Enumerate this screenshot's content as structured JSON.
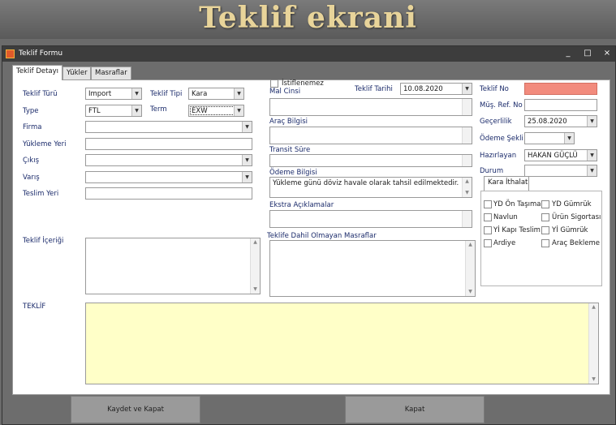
{
  "banner": {
    "title": "Teklif ekrani"
  },
  "window": {
    "title": "Teklif Formu",
    "minimize": "_",
    "maximize": "□",
    "close": "×"
  },
  "tabs": [
    {
      "label": "Teklif Detayı"
    },
    {
      "label": "Yükler"
    },
    {
      "label": "Masraflar"
    }
  ],
  "left": {
    "teklif_turu": {
      "label": "Teklif Türü",
      "value": "Import"
    },
    "teklif_tipi": {
      "label": "Teklif Tipi",
      "value": "Kara"
    },
    "type": {
      "label": "Type",
      "value": "FTL"
    },
    "term": {
      "label": "Term",
      "value": "EXW"
    },
    "firma": {
      "label": "Firma",
      "value": ""
    },
    "yukleme_yeri": {
      "label": "Yükleme Yeri",
      "value": ""
    },
    "cikis": {
      "label": "Çıkış",
      "value": ""
    },
    "varis": {
      "label": "Varış",
      "value": ""
    },
    "teslim_yeri": {
      "label": "Teslim Yeri",
      "value": ""
    },
    "teklif_icerigi": {
      "label": "Teklif İçeriği",
      "value": ""
    }
  },
  "middle": {
    "istiflenemez": {
      "label": "İstiflenemez",
      "checked": false
    },
    "teklif_tarihi": {
      "label": "Teklif Tarihi",
      "value": "10.08.2020"
    },
    "mal_cinsi": {
      "label": "Mal Cinsi",
      "value": ""
    },
    "arac_bilgisi": {
      "label": "Araç Bilgisi",
      "value": ""
    },
    "transit_sure": {
      "label": "Transit Süre",
      "value": ""
    },
    "odeme_bilgisi": {
      "label": "Ödeme Bilgisi",
      "value": "Yükleme günü döviz havale olarak tahsil edilmektedir."
    },
    "ekstra_aciklamalar": {
      "label": "Ekstra Açıklamalar",
      "value": ""
    },
    "dahil_olmayan": {
      "label": "Teklife Dahil Olmayan Masraflar",
      "value": ""
    }
  },
  "right": {
    "teklif_no": {
      "label": "Teklif No",
      "value": "",
      "color": "#f28b7d"
    },
    "mus_ref_no": {
      "label": "Müş. Ref. No",
      "value": ""
    },
    "gecerlilik": {
      "label": "Geçerlilik",
      "value": "25.08.2020"
    },
    "odeme_sekli": {
      "label": "Ödeme Şekli",
      "value": ""
    },
    "hazirlayan": {
      "label": "Hazırlayan",
      "value": "HAKAN GÜÇLÜ"
    },
    "durum": {
      "label": "Durum",
      "value": ""
    }
  },
  "kara_ithalat": {
    "title": "Kara İthalat",
    "items": [
      {
        "label": "YD Ön Taşıma",
        "checked": false
      },
      {
        "label": "YD Gümrük",
        "checked": false
      },
      {
        "label": "Navlun",
        "checked": false
      },
      {
        "label": "Ürün Sigortası",
        "checked": false
      },
      {
        "label": "Yİ Kapı Teslim",
        "checked": false
      },
      {
        "label": "Yİ Gümrük",
        "checked": false
      },
      {
        "label": "Ardiye",
        "checked": false
      },
      {
        "label": "Araç Bekleme",
        "checked": false
      }
    ]
  },
  "teklif": {
    "label": "TEKLİF",
    "value": "",
    "color": "#ffffc8"
  },
  "buttons": {
    "save_close": "Kaydet ve Kapat",
    "close": "Kapat"
  },
  "icons": {
    "dropdown": "▼",
    "scroll_up": "▲",
    "scroll_down": "▼"
  }
}
